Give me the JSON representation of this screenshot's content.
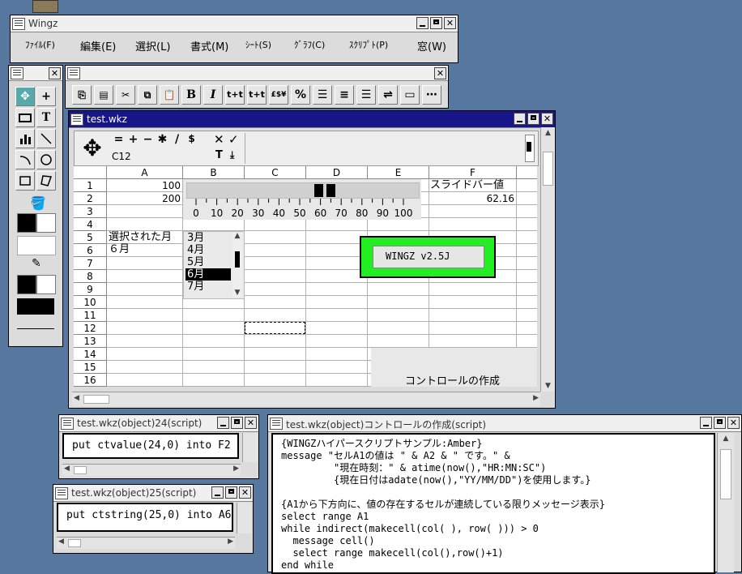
{
  "app": {
    "title": "Wingz",
    "menu": [
      "ﾌｧｲﾙ(F)",
      "編集(E)",
      "選択(L)",
      "書式(M)",
      "ｼｰﾄ(S)",
      "ｸﾞﾗﾌ(C)",
      "ｽｸﾘﾌﾟﾄ(P)",
      "窓(W)"
    ]
  },
  "format_toolbar": {
    "buttons": [
      "copy",
      "paste-special",
      "cut",
      "duplicate",
      "paste",
      "B",
      "I",
      "t+t",
      "t+t",
      "£$¥",
      "%",
      "align-left",
      "align-center",
      "align-right",
      "wrap",
      "border",
      "border-dotted"
    ]
  },
  "tool_palette": {
    "tools": [
      "cursor-icon",
      "plus-icon",
      "button-icon",
      "text-T-icon",
      "chart-icon",
      "line-icon",
      "arc-icon",
      "circle-icon",
      "rect-icon",
      "polygon-icon"
    ],
    "text_T": "T"
  },
  "sheet": {
    "title": "test.wkz",
    "cell_ref": "C12",
    "ops": [
      "=",
      "+",
      "−",
      "✱",
      "/",
      "$"
    ],
    "columns": [
      "A",
      "B",
      "C",
      "D",
      "E",
      "F"
    ],
    "rows": [
      "1",
      "2",
      "3",
      "4",
      "5",
      "6",
      "7",
      "8",
      "9",
      "10",
      "11",
      "12",
      "13",
      "14",
      "15",
      "16"
    ],
    "cells": {
      "A1": "100",
      "A2": "200",
      "A5": "選択された月",
      "A6": "６月",
      "F1": "スライドバー値",
      "F2": "62.16"
    },
    "slider": {
      "ticks": [
        "0",
        "10",
        "20",
        "30",
        "40",
        "50",
        "60",
        "70",
        "80",
        "90",
        "100"
      ],
      "value": 62.16
    },
    "listbox": {
      "items": [
        "3月",
        "4月",
        "5月",
        "6月",
        "7月"
      ],
      "selected": "6月"
    },
    "wingz_button": "WINGZ v2.5J",
    "control_label": "コントロールの作成"
  },
  "script24": {
    "title": "test.wkz(object)24(script)",
    "code": "put ctvalue(24,0) into F2"
  },
  "script25": {
    "title": "test.wkz(object)25(script)",
    "code": "put ctstring(25,0) into A6"
  },
  "script_main": {
    "title": "test.wkz(object)コントロールの作成(script)",
    "lines": [
      "{WINGZハイパースクリプトサンプル:Amber}",
      "message \"セルA1の値は \" & A2 & \" です。\" &",
      "         \"現在時刻：\" & atime(now(),\"HR:MN:SC\")",
      "         {現在日付はadate(now(),\"YY/MM/DD\")を使用します。}",
      "",
      "{A1から下方向に、値の存在するセルが連続している限りメッセージ表示}",
      "select range A1",
      "while indirect(makecell(col( ), row( ))) > 0",
      "  message cell()",
      "  select range makecell(col(),row()+1)",
      "end while"
    ]
  }
}
